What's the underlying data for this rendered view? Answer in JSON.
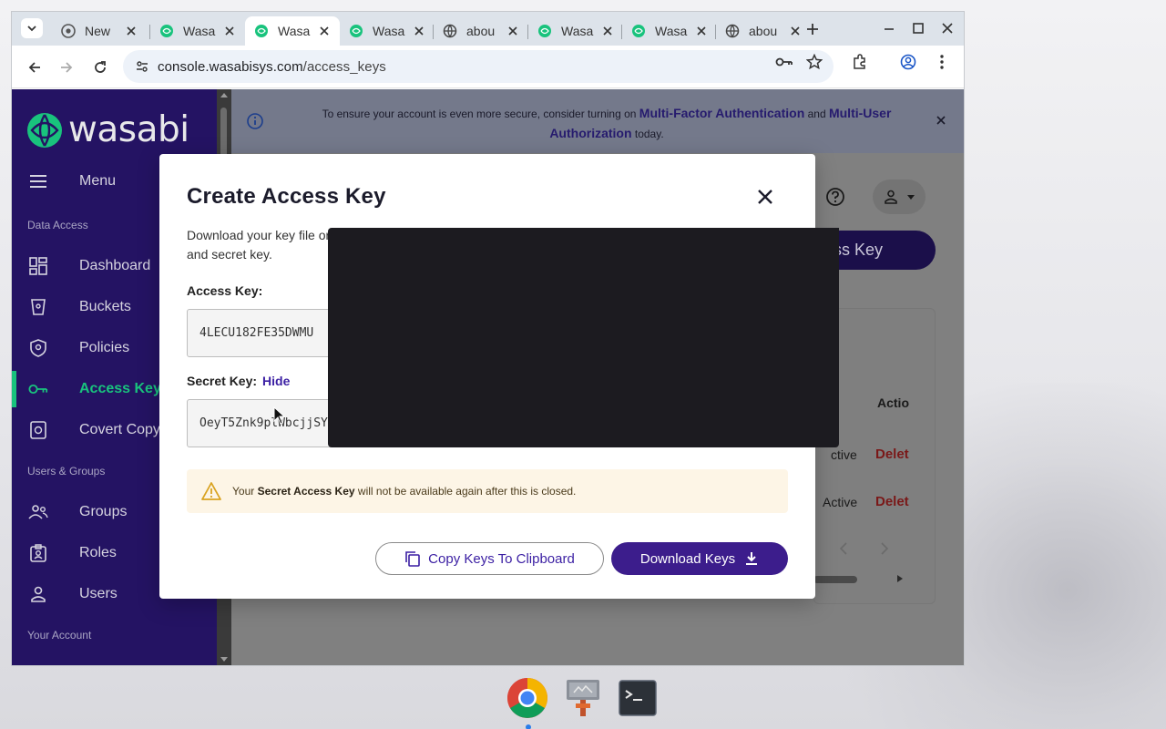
{
  "tabs": [
    {
      "title": "New",
      "favicon": "chrome-icon",
      "active": false
    },
    {
      "title": "Wasa",
      "favicon": "wasabi-icon",
      "active": false
    },
    {
      "title": "Wasa",
      "favicon": "wasabi-icon",
      "active": true
    },
    {
      "title": "Wasa",
      "favicon": "wasabi-icon",
      "active": false
    },
    {
      "title": "abou",
      "favicon": "globe-icon",
      "active": false
    },
    {
      "title": "Wasa",
      "favicon": "wasabi-icon",
      "active": false
    },
    {
      "title": "Wasa",
      "favicon": "wasabi-icon",
      "active": false
    },
    {
      "title": "abou",
      "favicon": "globe-icon",
      "active": false
    }
  ],
  "address": {
    "host": "console.wasabisys.com",
    "path": "/access_keys"
  },
  "brand": {
    "name": "wasabi",
    "accent": "#19c37d",
    "sidebar_bg": "#241363",
    "primary": "#3c1d8c"
  },
  "sidebar": {
    "menu_label": "Menu",
    "sections": {
      "data_access": "Data Access",
      "users_groups": "Users & Groups",
      "account": "Your Account"
    },
    "items": [
      {
        "label": "Dashboard",
        "icon": "dashboard-icon"
      },
      {
        "label": "Buckets",
        "icon": "bucket-icon"
      },
      {
        "label": "Policies",
        "icon": "shield-icon"
      },
      {
        "label": "Access Keys",
        "icon": "key-icon",
        "active": true
      },
      {
        "label": "Covert Copy",
        "icon": "vault-icon"
      },
      {
        "label": "Groups",
        "icon": "groups-icon"
      },
      {
        "label": "Roles",
        "icon": "badge-icon"
      },
      {
        "label": "Users",
        "icon": "user-icon"
      }
    ]
  },
  "banner": {
    "text_before": "To ensure your account is even more secure, consider turning on",
    "link1": "Multi-Factor Authentication",
    "and": "and",
    "link2": "Multi-User Authorization",
    "text_after": "today."
  },
  "background_page": {
    "create_button": "ss Key",
    "table_header_actions": "Actio",
    "rows": [
      {
        "status": "ctive",
        "action": "Delet"
      },
      {
        "status": "Active",
        "action": "Delet"
      }
    ]
  },
  "modal": {
    "title": "Create Access Key",
    "intro_line1": "Download your key file or",
    "intro_line2": "and secret key.",
    "access_key_label": "Access Key:",
    "access_key_value": "4LECU182FE35DWMU",
    "secret_key_label": "Secret Key:",
    "hide_link": "Hide",
    "secret_key_value": "OeyT5Znk9plWbcjjSY",
    "warning_before": "Your",
    "warning_bold": "Secret Access Key",
    "warning_after": "will not be available again after this is closed.",
    "copy_button": "Copy Keys To Clipboard",
    "download_button": "Download Keys"
  },
  "taskbar": [
    "chrome-icon",
    "file-manager-icon",
    "terminal-icon"
  ]
}
